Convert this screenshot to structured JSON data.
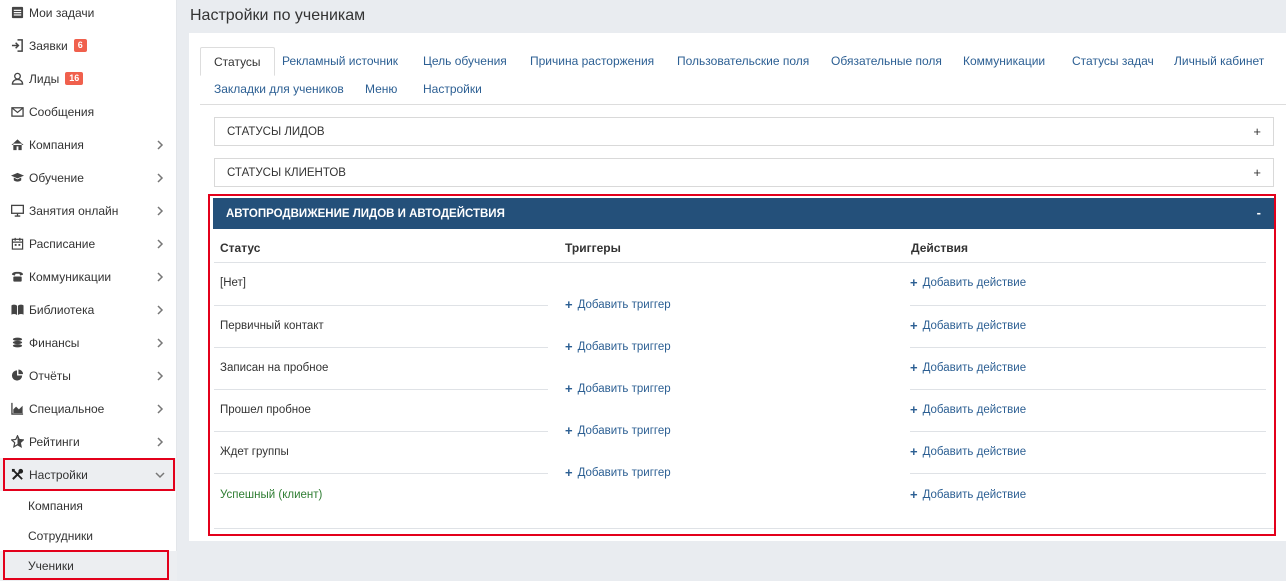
{
  "sidebar": {
    "items": [
      {
        "label": "Мои задачи",
        "icon": "list-icon"
      },
      {
        "label": "Заявки",
        "icon": "sign-in-icon",
        "badge": "6"
      },
      {
        "label": "Лиды",
        "icon": "user-icon",
        "badge": "16"
      },
      {
        "label": "Сообщения",
        "icon": "envelope-icon"
      },
      {
        "label": "Компания",
        "icon": "home-icon"
      },
      {
        "label": "Обучение",
        "icon": "graduation-cap-icon"
      },
      {
        "label": "Занятия онлайн",
        "icon": "monitor-icon"
      },
      {
        "label": "Расписание",
        "icon": "calendar-icon"
      },
      {
        "label": "Коммуникации",
        "icon": "phone-icon"
      },
      {
        "label": "Библиотека",
        "icon": "book-icon"
      },
      {
        "label": "Финансы",
        "icon": "coins-icon"
      },
      {
        "label": "Отчёты",
        "icon": "pie-chart-icon"
      },
      {
        "label": "Специальное",
        "icon": "area-chart-icon"
      },
      {
        "label": "Рейтинги",
        "icon": "star-icon"
      },
      {
        "label": "Настройки",
        "icon": "tools-icon"
      }
    ],
    "sub_items": [
      {
        "label": "Компания"
      },
      {
        "label": "Сотрудники"
      },
      {
        "label": "Ученики"
      }
    ]
  },
  "header": {
    "title": "Настройки по ученикам"
  },
  "tabs": [
    {
      "label": "Статусы"
    },
    {
      "label": "Рекламный источник"
    },
    {
      "label": "Цель обучения"
    },
    {
      "label": "Причина расторжения"
    },
    {
      "label": "Пользовательские поля"
    },
    {
      "label": "Обязательные поля"
    },
    {
      "label": "Коммуникации"
    },
    {
      "label": "Статусы задач"
    },
    {
      "label": "Личный кабинет"
    },
    {
      "label": "Закладки для учеников"
    },
    {
      "label": "Меню"
    },
    {
      "label": "Настройки"
    }
  ],
  "accordions": {
    "leads": {
      "title": "СТАТУСЫ ЛИДОВ",
      "toggle": "+"
    },
    "clients": {
      "title": "СТАТУСЫ КЛИЕНТОВ",
      "toggle": "+"
    },
    "auto": {
      "title": "АВТОПРОДВИЖЕНИЕ ЛИДОВ И АВТОДЕЙСТВИЯ",
      "toggle": "-"
    }
  },
  "table": {
    "headers": {
      "status": "Статус",
      "triggers": "Триггеры",
      "actions": "Действия"
    },
    "rows": [
      {
        "status": "[Нет]",
        "action": "Добавить действие"
      },
      {
        "status": "Первичный контакт",
        "action": "Добавить действие"
      },
      {
        "status": "Записан на пробное",
        "action": "Добавить действие"
      },
      {
        "status": "Прошел пробное",
        "action": "Добавить действие"
      },
      {
        "status": "Ждет группы",
        "action": "Добавить действие"
      },
      {
        "status": "Успешный (клиент)",
        "action": "Добавить действие"
      }
    ],
    "triggers": [
      "Добавить триггер",
      "Добавить триггер",
      "Добавить триггер",
      "Добавить триггер",
      "Добавить триггер"
    ]
  },
  "colors": {
    "accent": "#24507a",
    "link": "#2c5f93",
    "highlight": "#e3001b",
    "badge": "#f0604d",
    "success": "#2e7d32"
  }
}
